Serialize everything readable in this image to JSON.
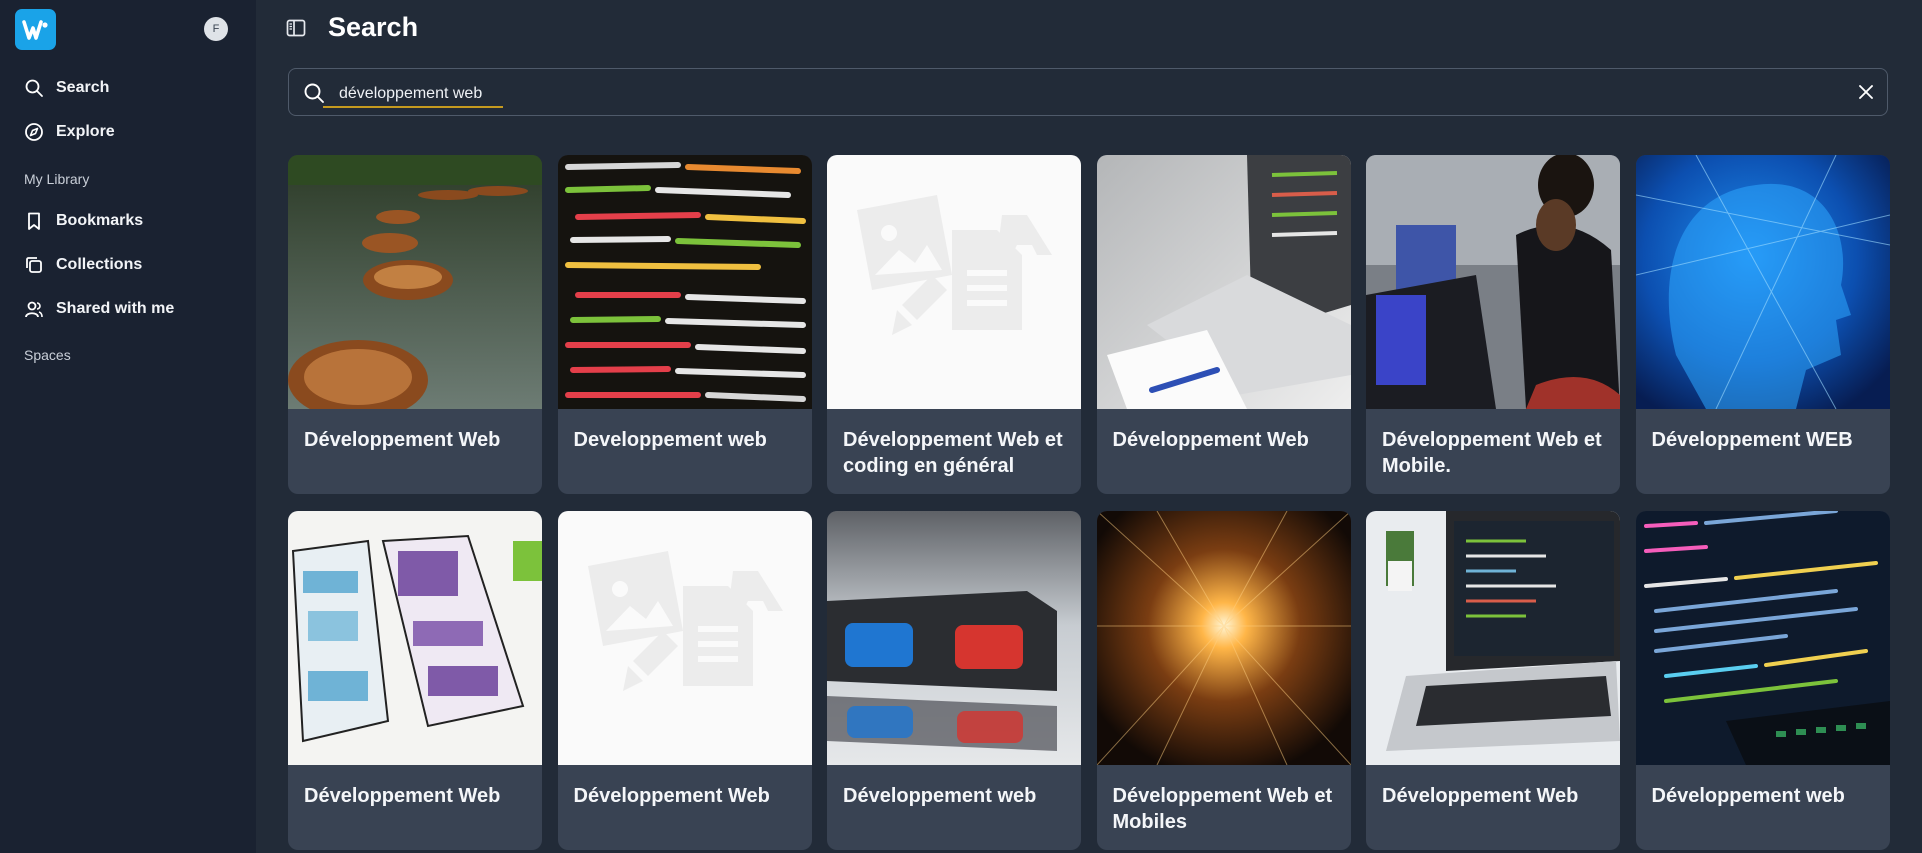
{
  "sidebar": {
    "avatar_initial": "F",
    "nav": [
      {
        "label": "Search",
        "icon": "search-icon"
      },
      {
        "label": "Explore",
        "icon": "compass-icon"
      }
    ],
    "library_label": "My Library",
    "library": [
      {
        "label": "Bookmarks",
        "icon": "bookmark-icon"
      },
      {
        "label": "Collections",
        "icon": "collections-icon"
      },
      {
        "label": "Shared with me",
        "icon": "users-icon"
      }
    ],
    "spaces_label": "Spaces"
  },
  "header": {
    "title": "Search"
  },
  "search": {
    "value": "développement web",
    "placeholder": ""
  },
  "results": [
    {
      "title": "Développement Web",
      "thumb": "lake-boats"
    },
    {
      "title": "Developpement web",
      "thumb": "html-code-closeup"
    },
    {
      "title": "Développement Web et coding en général",
      "thumb": "placeholder"
    },
    {
      "title": "Développement Web",
      "thumb": "laptop-notebook"
    },
    {
      "title": "Développement Web et Mobile.",
      "thumb": "woman-laptop-office"
    },
    {
      "title": "Développement WEB",
      "thumb": "blue-digital-head"
    },
    {
      "title": "Développement Web",
      "thumb": "wireframe-sketch"
    },
    {
      "title": "Développement Web",
      "thumb": "placeholder"
    },
    {
      "title": "Développement web",
      "thumb": "3d-glasses"
    },
    {
      "title": "Développement Web et Mobiles",
      "thumb": "light-tunnel"
    },
    {
      "title": "Développement Web",
      "thumb": "laptop-code-desk"
    },
    {
      "title": "Développement web",
      "thumb": "code-screen-angled"
    }
  ],
  "colors": {
    "sidebar_bg": "#1a2231",
    "main_bg": "#222b38",
    "card_bg": "#394353",
    "accent": "#1aa3e8",
    "input_underline": "#c59a1f"
  }
}
